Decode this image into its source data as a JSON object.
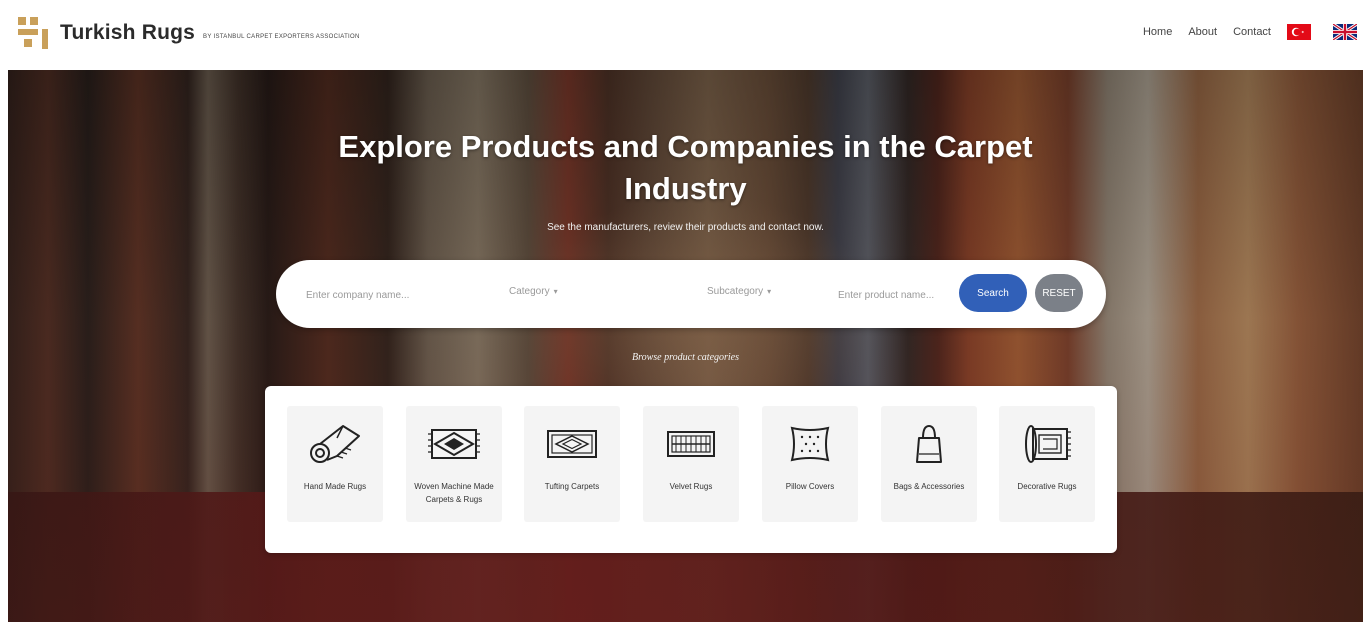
{
  "header": {
    "logo_title": "Turkish Rugs",
    "logo_sub": "BY ISTANBUL CARPET EXPORTERS ASSOCIATION",
    "nav": [
      "Home",
      "About",
      "Contact"
    ],
    "lang_flags": [
      "turkey-flag-icon",
      "uk-flag-icon"
    ]
  },
  "hero": {
    "title_line1": "Explore Products and Companies in the Carpet",
    "title_line2": "Industry",
    "subtitle": "See the manufacturers, review their products and contact now."
  },
  "search": {
    "company_placeholder": "Enter company name...",
    "category_label": "Category",
    "subcategory_label": "Subcategory",
    "product_placeholder": "Enter product name...",
    "search_label": "Search",
    "reset_label": "RESET",
    "search_color": "#3160b8",
    "reset_color": "#7b8088"
  },
  "browse_label": "Browse product categories",
  "categories": [
    {
      "label": "Hand Made Rugs",
      "icon": "rolled-rug-icon"
    },
    {
      "label": "Woven Machine Made Carpets & Rugs",
      "icon": "diamond-rug-icon"
    },
    {
      "label": "Tufting Carpets",
      "icon": "tufted-carpet-icon"
    },
    {
      "label": "Velvet Rugs",
      "icon": "velvet-rug-icon"
    },
    {
      "label": "Pillow Covers",
      "icon": "pillow-icon"
    },
    {
      "label": "Bags & Accessories",
      "icon": "bag-icon"
    },
    {
      "label": "Decorative Rugs",
      "icon": "decorative-rug-icon"
    }
  ]
}
